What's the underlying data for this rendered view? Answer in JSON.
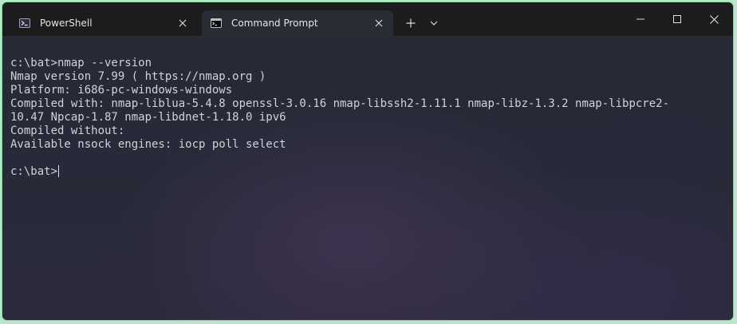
{
  "tabs": [
    {
      "label": "PowerShell",
      "icon": "powershell-icon",
      "active": false
    },
    {
      "label": "Command Prompt",
      "icon": "cmd-icon",
      "active": true
    }
  ],
  "titlebar": {
    "new_tab_icon": "plus-icon",
    "dropdown_icon": "chevron-down-icon",
    "minimize_icon": "minimize-icon",
    "maximize_icon": "maximize-icon",
    "close_icon": "close-icon"
  },
  "terminal": {
    "lines": [
      "c:\\bat>nmap --version",
      "Nmap version 7.99 ( https://nmap.org )",
      "Platform: i686-pc-windows-windows",
      "Compiled with: nmap-liblua-5.4.8 openssl-3.0.16 nmap-libssh2-1.11.1 nmap-libz-1.3.2 nmap-libpcre2-",
      "10.47 Npcap-1.87 nmap-libdnet-1.18.0 ipv6",
      "Compiled without:",
      "Available nsock engines: iocp poll select",
      ""
    ],
    "prompt": "c:\\bat>"
  },
  "colors": {
    "titlebar_bg": "#1c1c1c",
    "active_tab_bg": "#282c34",
    "terminal_text": "#cfd3da",
    "window_border": "#7fd69b"
  }
}
